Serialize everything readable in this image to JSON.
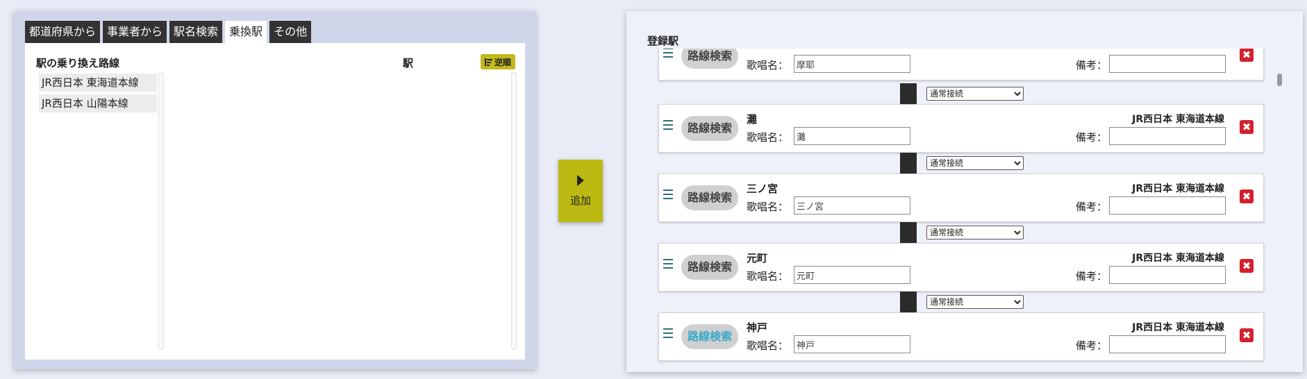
{
  "tabs": [
    {
      "label": "都道府県から"
    },
    {
      "label": "事業者から"
    },
    {
      "label": "駅名検索"
    },
    {
      "label": "乗換駅"
    },
    {
      "label": "その他"
    }
  ],
  "left": {
    "routes_header": "駅の乗り換え路線",
    "stations_header": "駅",
    "reverse_label": "逆順",
    "routes": [
      {
        "label": "JR西日本 東海道本線"
      },
      {
        "label": "JR西日本 山陽本線"
      }
    ]
  },
  "add_button": {
    "label": "追加"
  },
  "right": {
    "title": "登録駅",
    "search_label": "路線検索",
    "lyric_label": "歌唱名：",
    "remark_label": "備考：",
    "delete_symbol": "✖",
    "connector_option": "通常接続",
    "stations": [
      {
        "name": "",
        "line": "",
        "lyric": "摩耶",
        "remark": ""
      },
      {
        "name": "灘",
        "line": "JR西日本 東海道本線",
        "lyric": "灘",
        "remark": ""
      },
      {
        "name": "三ノ宮",
        "line": "JR西日本 東海道本線",
        "lyric": "三ノ宮",
        "remark": ""
      },
      {
        "name": "元町",
        "line": "JR西日本 東海道本線",
        "lyric": "元町",
        "remark": ""
      },
      {
        "name": "神戸",
        "line": "JR西日本 東海道本線",
        "lyric": "神戸",
        "remark": ""
      }
    ]
  },
  "colors": {
    "accent_yellow": "#c3b91a",
    "delete_red": "#d4202c",
    "tab_dark": "#333333",
    "active_search_text": "#3aa9c6"
  }
}
